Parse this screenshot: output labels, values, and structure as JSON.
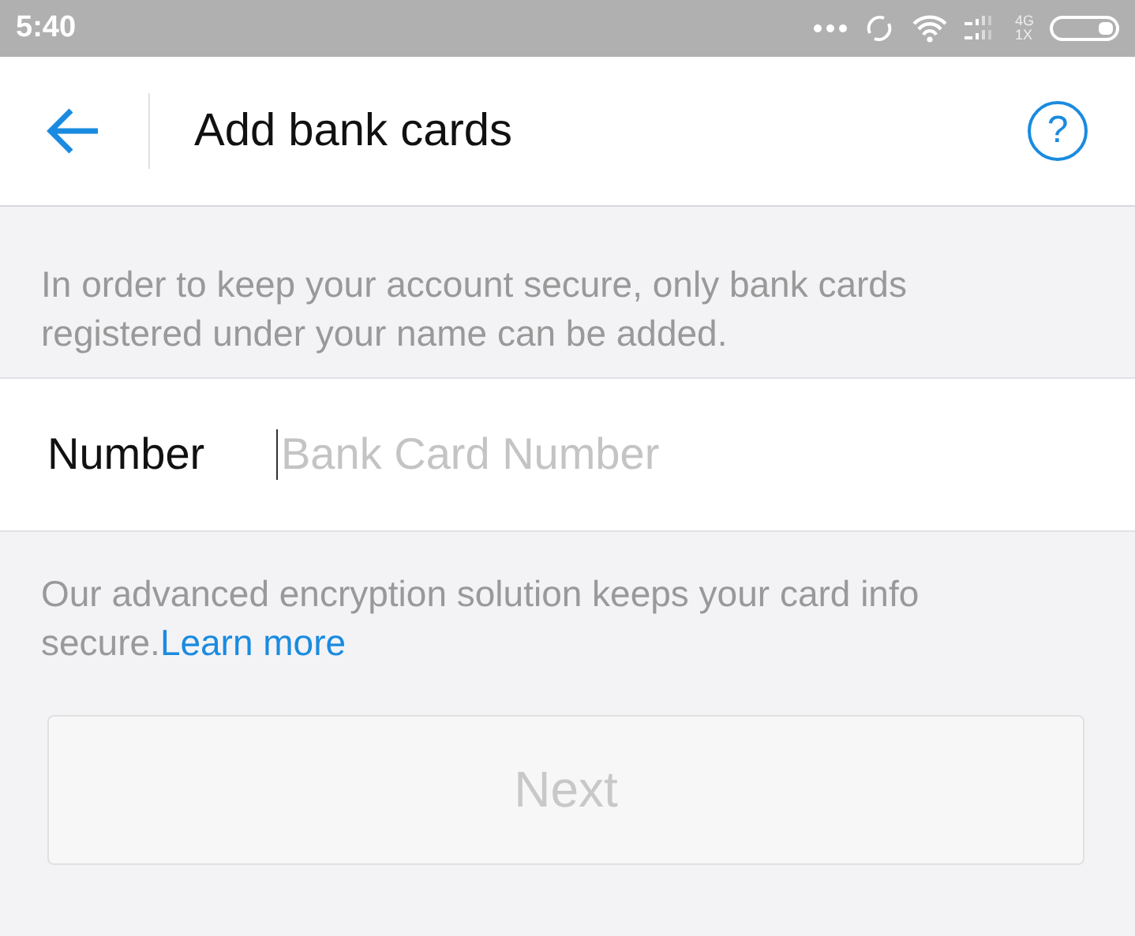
{
  "status_bar": {
    "time": "5:40",
    "network_top": "4G",
    "network_bottom": "1X"
  },
  "header": {
    "title": "Add bank cards",
    "help": "?"
  },
  "notice": "In order to keep your account secure, only bank cards registered under your name can be added.",
  "field": {
    "label": "Number",
    "placeholder": "Bank Card Number"
  },
  "info": {
    "text": "Our advanced encryption solution keeps your card info secure.",
    "link": "Learn more"
  },
  "button": {
    "label": "Next",
    "disabled": true
  }
}
